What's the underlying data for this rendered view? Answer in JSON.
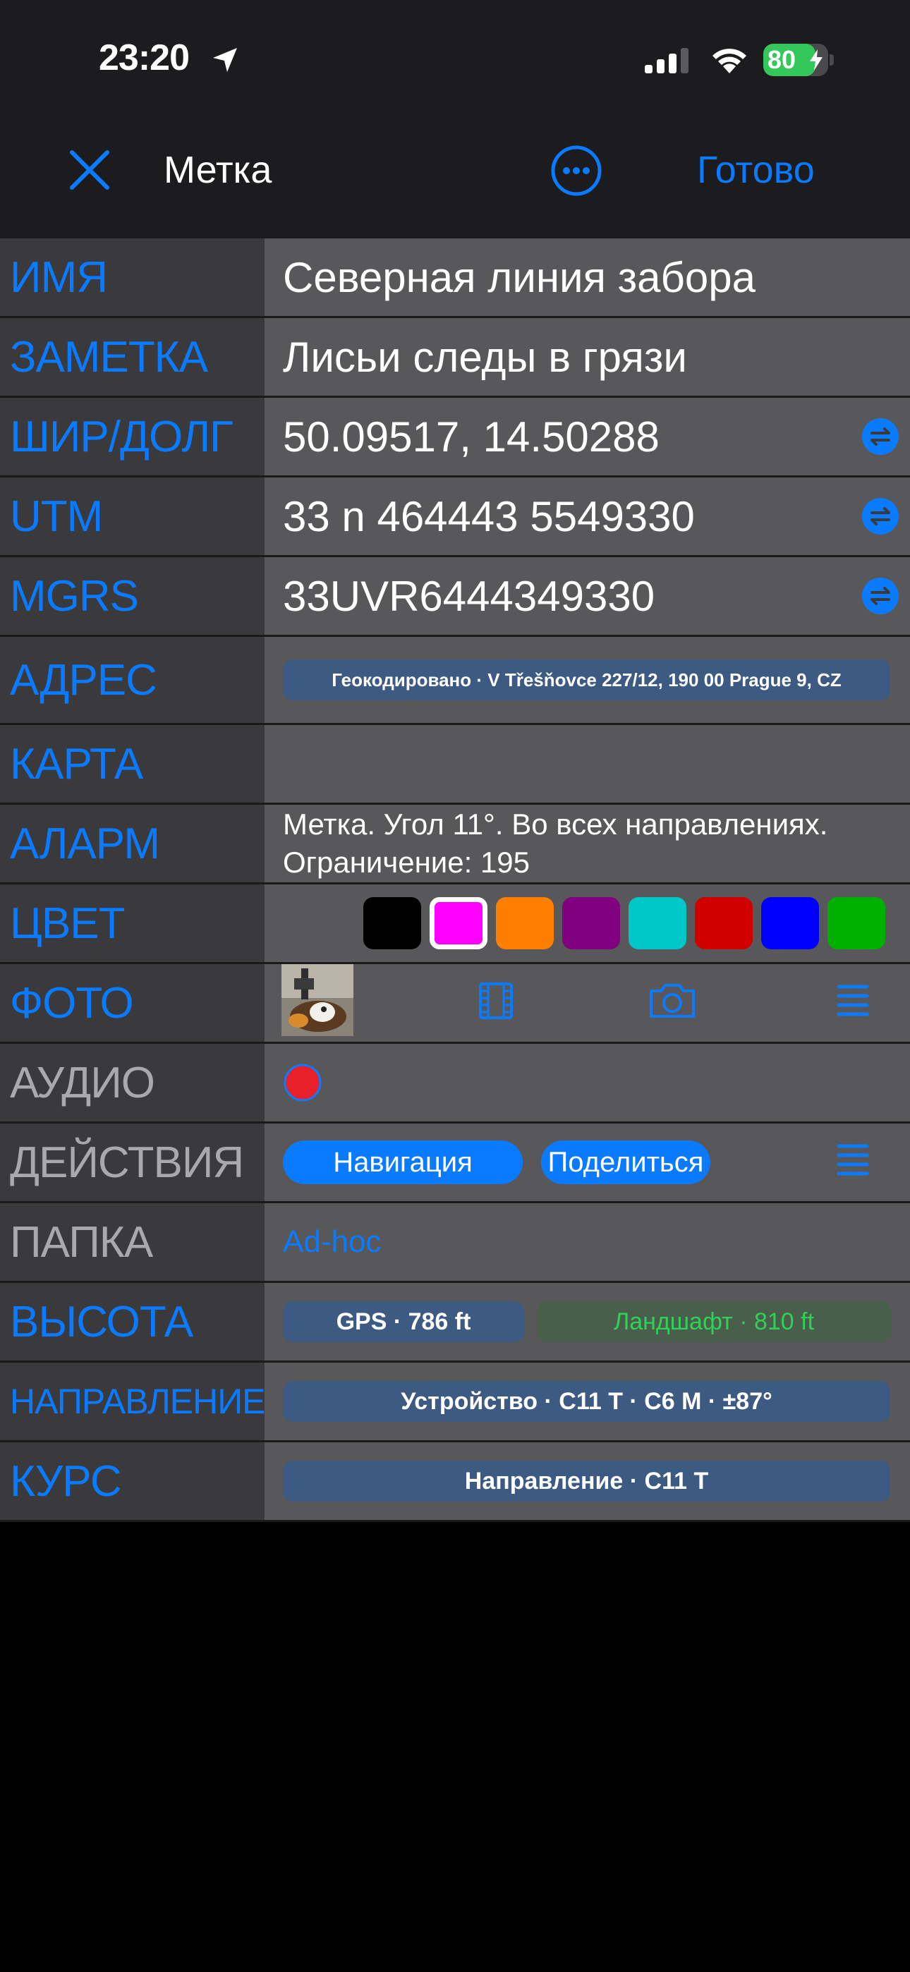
{
  "status_bar": {
    "time": "23:20",
    "battery": "80",
    "battery_level": 0.8,
    "colors": {
      "battery": "#34c759"
    }
  },
  "navbar": {
    "title": "Метка",
    "done_label": "Готово",
    "close_icon": "close-icon",
    "more_icon": "more-icon"
  },
  "accent_color": "#0a7aff",
  "rows": {
    "name": {
      "label": "ИМЯ",
      "value": "Северная линия забора"
    },
    "note": {
      "label": "ЗАМЕТКА",
      "value": "Лисьи следы в грязи"
    },
    "latlon": {
      "label": "ШИР/ДОЛГ",
      "value": "50.09517, 14.50288"
    },
    "utm": {
      "label": "UTM",
      "value": "33 n 464443 5549330"
    },
    "mgrs": {
      "label": "MGRS",
      "value": "33UVR6444349330"
    },
    "address": {
      "label": "АДРЕС",
      "value": "Геокодировано · V Třešňovce 227/12, 190 00 Prague 9, CZ"
    },
    "map": {
      "label": "КАРТА"
    },
    "alarm": {
      "label": "АЛАРМ",
      "line1": "Метка. Угол 11°.  Во всех направлениях.",
      "line2": "Ограничение: 195"
    },
    "color": {
      "label": "ЦВЕТ",
      "swatches": [
        "#000000",
        "#ff00ff",
        "#ff8000",
        "#800080",
        "#00c8c8",
        "#d00000",
        "#0000ff",
        "#00b000"
      ],
      "selected": "#ff00ff"
    },
    "photo": {
      "label": "ФОТО",
      "icons": [
        "film-icon",
        "camera-icon",
        "list-icon"
      ]
    },
    "audio": {
      "label": "АУДИО",
      "record_color": "#e8202a"
    },
    "actions": {
      "label": "ДЕЙСТВИЯ",
      "navigate": "Навигация",
      "share": "Поделиться"
    },
    "folder": {
      "label": "ПАПКА",
      "value": "Ad-hoc"
    },
    "altitude": {
      "label": "ВЫСОТА",
      "gps": "GPS · 786 ft",
      "terrain": "Ландшафт · 810 ft",
      "terrain_color": "#30d158"
    },
    "direction": {
      "label": "НАПРАВЛЕНИЕ",
      "value": "Устройство · С11 Т · С6 М · ±87°"
    },
    "course": {
      "label": "КУРС",
      "value": "Направление · С11 Т"
    }
  }
}
